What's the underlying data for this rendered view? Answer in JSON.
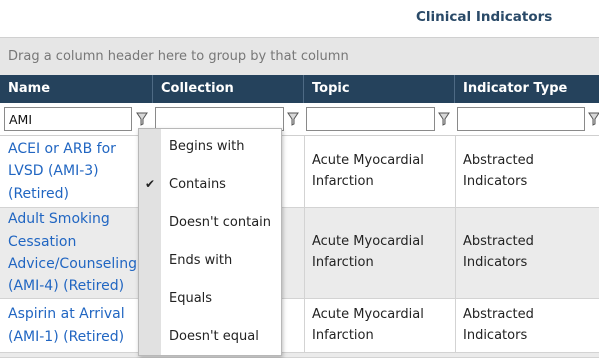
{
  "title": "Clinical Indicators",
  "group_hint": "Drag a column header here to group by that column",
  "columns": [
    "Name",
    "Collection",
    "Topic",
    "Indicator Type"
  ],
  "filters": {
    "name_value": "AMI",
    "collection_value": "",
    "topic_value": "",
    "type_value": ""
  },
  "rows": [
    {
      "name": "ACEI or ARB for LVSD (AMI-3) (Retired)",
      "topic": "Acute Myocardial Infarction",
      "type": "Abstracted Indicators"
    },
    {
      "name": "Adult Smoking Cessation Advice/Counseling (AMI-4) (Retired)",
      "topic": "Acute Myocardial Infarction",
      "type": "Abstracted Indicators"
    },
    {
      "name": "Aspirin at Arrival (AMI-1) (Retired)",
      "topic": "Acute Myocardial Infarction",
      "type": "Abstracted Indicators"
    }
  ],
  "filter_menu": {
    "options": [
      "Begins with",
      "Contains",
      "Doesn't contain",
      "Ends with",
      "Equals",
      "Doesn't equal"
    ],
    "selected": "Contains",
    "check_mark": "✔"
  },
  "colors": {
    "header_bg": "#25425c",
    "title_color": "#2a4a68",
    "link_color": "#2166c2",
    "group_panel_bg": "#e6e6e6",
    "alt_row_bg": "#ebebeb"
  }
}
